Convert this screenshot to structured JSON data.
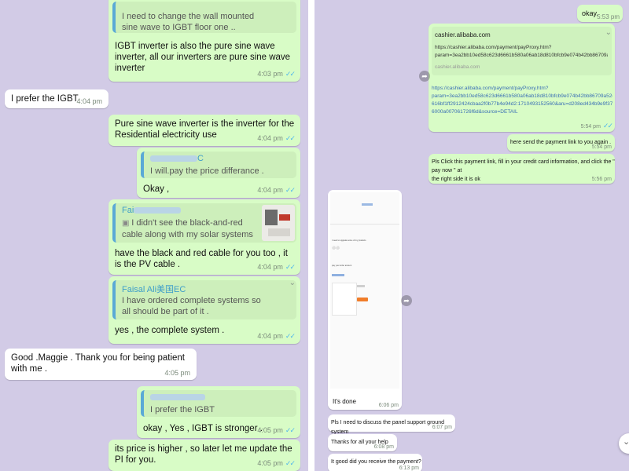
{
  "left_chat": {
    "m1": {
      "quote_text": "I need to change the wall mounted\nsine wave to IGBT floor one ..",
      "body": "IGBT inverter is also the pure sine wave\ninverter, all our inverters are pure sine wave\ninverter",
      "time": "4:03 pm"
    },
    "m2": {
      "body": "I prefer the IGBT",
      "time": "4:04 pm"
    },
    "m3": {
      "body": "Pure sine wave inverter is the inverter for the\nResidential electricity use",
      "time": "4:04 pm"
    },
    "m4": {
      "quote_name": "C",
      "quote_text": "I will.pay the price differance .",
      "body": "Okay ,",
      "time": "4:04 pm"
    },
    "m5": {
      "quote_name": "Fai",
      "quote_text": "I didn't see the black-and-red\ncable along with my  solar systems",
      "body": "have the black and red cable for you too , it\nis the PV cable .",
      "time": "4:04 pm"
    },
    "m6": {
      "quote_name": "Faisal Ali美国EC",
      "quote_text": "I have ordered complete systems so\nall should be part of it .",
      "body": "yes , the complete system .",
      "time": "4:04 pm"
    },
    "m7": {
      "body": "Good .Maggie . Thank you for being patient\nwith me .",
      "time": "4:05 pm"
    },
    "m8": {
      "quote_text": "I prefer the IGBT",
      "body": "okay , Yes , IGBT is stronger .",
      "time": "4:05 pm"
    },
    "m9": {
      "body": "its price is higher , so later let me update the\nPI for you.",
      "time": "4:05 pm"
    }
  },
  "right_chat": {
    "r1": {
      "body": "okay.",
      "time": "5:53 pm"
    },
    "r2": {
      "preview_domain": "cashier.alibaba.com",
      "preview_url": "https://cashier.alibaba.com/payment/payProxy.htm?\nparam=3ea2bb10ed58c623d6661b580a06ab18d810bfcb9e074b42bb86709a52e33d2-...",
      "preview_site": "cashier.alibaba.com",
      "body": "https://cashier.alibaba.com/payment/payProxy.htm?\nparam=3ea2bb10ed58c623d6661b580a06ab18d810bfcb9e074b42bb86709a52e33d2-\n616bf1ff2912424cbaa2f0b77b4e94d2:1710493152560&aru=d208ed434b9e9f37bf00b4003\n6000a007061726f6d&source=DETAIL",
      "time": "5:54 pm"
    },
    "r3": {
      "body": "here send the payment link to you again .",
      "time": "5:54 pm"
    },
    "r4": {
      "body": "Pls Click this payment link,  fill in your credit card information, and click the \" pay now \" at\nthe right side  it is ok",
      "time": "5:56 pm"
    },
    "r5": {
      "shot_line1": "I need to upgrade some of my products",
      "shot_line2": "pay your order amount",
      "caption": "It's done",
      "time": "6:06 pm"
    },
    "r6": {
      "body": "Pls I need to discuss the panel support ground system",
      "time": "6:07 pm"
    },
    "r7": {
      "body": "Thanks for all your help",
      "time": "6:08 pm"
    },
    "r8": {
      "body": "It good did you receive the payment?",
      "time": "6:13 pm"
    }
  },
  "icons": {
    "read": "double-check-icon",
    "forward": "forward-icon",
    "menu": "chevron-down-icon"
  },
  "colors": {
    "outgoing": "#d8fcc6",
    "incoming": "#ffffff",
    "wallpaper": "#d2cbe6",
    "quote_accent": "#5aa9d6"
  }
}
